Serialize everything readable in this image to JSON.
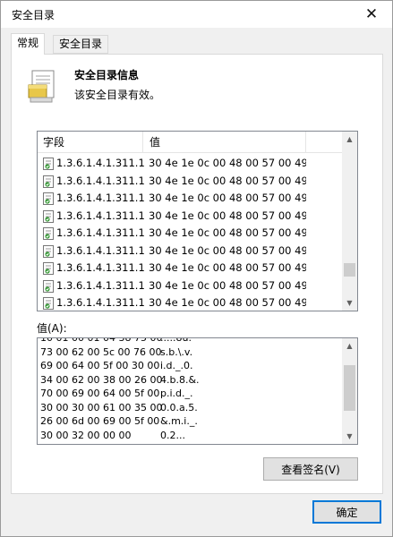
{
  "window": {
    "title": "安全目录",
    "close_glyph": "✕"
  },
  "tabs": [
    {
      "label": "常规",
      "active": true
    },
    {
      "label": "安全目录",
      "active": false
    }
  ],
  "info": {
    "icon": "certificate-document-icon",
    "title": "安全目录信息",
    "subtitle": "该安全目录有效。"
  },
  "fields_list": {
    "columns": [
      "字段",
      "值"
    ],
    "rows": [
      {
        "icon": "field-entry-icon",
        "field": "1.3.6.1.4.1.311.1...",
        "value": "30 4e 1e 0c 00 48 00 57 00 49 ..."
      },
      {
        "icon": "field-entry-icon",
        "field": "1.3.6.1.4.1.311.1...",
        "value": "30 4e 1e 0c 00 48 00 57 00 49 ..."
      },
      {
        "icon": "field-entry-icon",
        "field": "1.3.6.1.4.1.311.1...",
        "value": "30 4e 1e 0c 00 48 00 57 00 49 ..."
      },
      {
        "icon": "field-entry-icon",
        "field": "1.3.6.1.4.1.311.1...",
        "value": "30 4e 1e 0c 00 48 00 57 00 49 ..."
      },
      {
        "icon": "field-entry-icon",
        "field": "1.3.6.1.4.1.311.1...",
        "value": "30 4e 1e 0c 00 48 00 57 00 49 ..."
      },
      {
        "icon": "field-entry-icon",
        "field": "1.3.6.1.4.1.311.1...",
        "value": "30 4e 1e 0c 00 48 00 57 00 49 ..."
      },
      {
        "icon": "field-entry-icon",
        "field": "1.3.6.1.4.1.311.1...",
        "value": "30 4e 1e 0c 00 48 00 57 00 49 ..."
      },
      {
        "icon": "field-entry-icon",
        "field": "1.3.6.1.4.1.311.1...",
        "value": "30 4e 1e 0c 00 48 00 57 00 49 ..."
      },
      {
        "icon": "field-entry-icon",
        "field": "1.3.6.1.4.1.311.1...",
        "value": "30 4e 1e 0c 00 48 00 57 00 49 ..."
      }
    ]
  },
  "value_section": {
    "label": "值(A):",
    "lines": [
      {
        "hex": "10 01 00 01 04 38 75 00",
        "ascii": ".....8u."
      },
      {
        "hex": "73 00 62 00 5c 00 76 00",
        "ascii": "s.b.\\.v."
      },
      {
        "hex": "69 00 64 00 5f 00 30 00",
        "ascii": "i.d._.0."
      },
      {
        "hex": "34 00 62 00 38 00 26 00",
        "ascii": "4.b.8.&."
      },
      {
        "hex": "70 00 69 00 64 00 5f 00",
        "ascii": "p.i.d._."
      },
      {
        "hex": "30 00 30 00 61 00 35 00",
        "ascii": "0.0.a.5."
      },
      {
        "hex": "26 00 6d 00 69 00 5f 00",
        "ascii": "&.m.i._."
      },
      {
        "hex": "30 00 32 00 00 00",
        "ascii": "0.2..."
      }
    ]
  },
  "buttons": {
    "view_signature": "查看签名(V)",
    "ok": "确定"
  },
  "scroll": {
    "fields_thumb_fraction": 0.09,
    "fields_thumb_position": 0.86,
    "value_thumb_fraction": 0.6,
    "value_thumb_position": 0.4
  }
}
